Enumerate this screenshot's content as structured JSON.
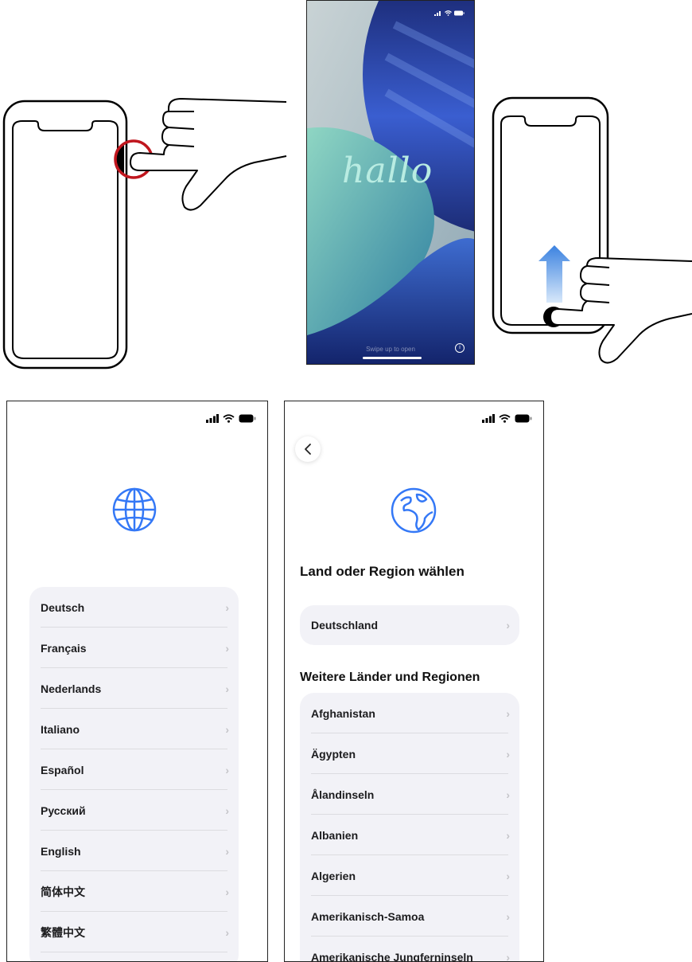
{
  "lock_screen": {
    "greeting": "hallo",
    "swipe_hint": "Swipe up to open"
  },
  "language_screen": {
    "icon": "globe-icon",
    "languages": [
      {
        "label": "Deutsch"
      },
      {
        "label": "Français"
      },
      {
        "label": "Nederlands"
      },
      {
        "label": "Italiano"
      },
      {
        "label": "Español"
      },
      {
        "label": "Русский"
      },
      {
        "label": "English"
      },
      {
        "label": "简体中文"
      },
      {
        "label": "繁體中文"
      }
    ]
  },
  "region_screen": {
    "icon": "earth-icon",
    "title": "Land oder Region wählen",
    "suggested": {
      "label": "Deutschland"
    },
    "more_heading": "Weitere Länder und Regionen",
    "regions": [
      {
        "label": "Afghanistan"
      },
      {
        "label": "Ägypten"
      },
      {
        "label": "Ålandinseln"
      },
      {
        "label": "Albanien"
      },
      {
        "label": "Algerien"
      },
      {
        "label": "Amerikanisch-Samoa"
      },
      {
        "label": "Amerikanische Jungferninseln"
      }
    ]
  },
  "colors": {
    "accent": "#3478f6",
    "list_bg": "#f2f2f7",
    "power_highlight": "#c0161e"
  }
}
